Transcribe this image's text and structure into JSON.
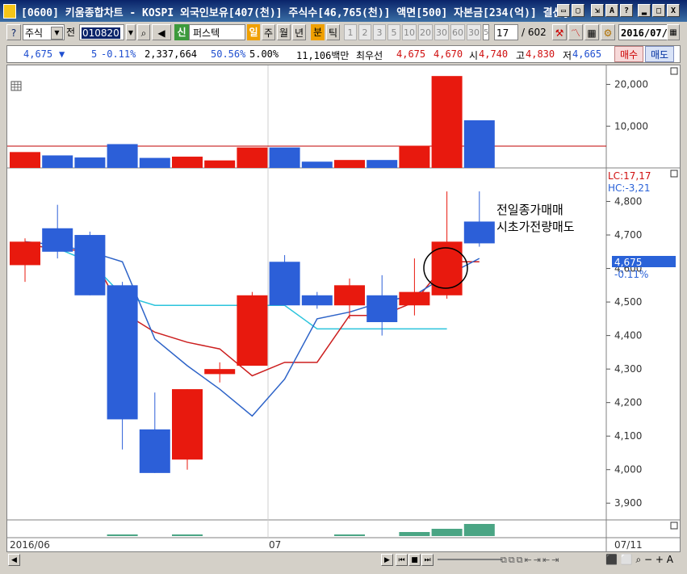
{
  "window": {
    "title": "[0600] 키움종합차트 - KOSPI 외국인보유[407(천)] 주식수[46,765(천)] 액면[500] 자본금[234(억)] 결산[",
    "controls": [
      "▭",
      "▢",
      "⇲",
      "A",
      "?",
      "▂",
      "□",
      "X"
    ]
  },
  "toolbar": {
    "market_label": "주식",
    "prev_label": "전",
    "code_value": "010820",
    "stock_name": "퍼스텍",
    "credit_label": "신",
    "period_tabs": [
      "일",
      "주",
      "월",
      "년",
      "분",
      "틱"
    ],
    "active_period": "일",
    "intervals": [
      "1",
      "2",
      "3",
      "5",
      "10",
      "20",
      "30",
      "60",
      "30",
      "5"
    ],
    "count_value": "17",
    "total_count": "/ 602",
    "date_value": "2016/07/1"
  },
  "quote": {
    "price": "4,675",
    "direction": "▼",
    "change": "5",
    "change_pct": "-0.11%",
    "volume": "2,337,664",
    "volume_ratio": "50.56%",
    "rate": "5.00%",
    "amount": "11,106백만",
    "best_label": "최우선",
    "ask": "4,675",
    "bid": "4,670",
    "open_label": "시",
    "open": "4,740",
    "high_label": "고",
    "high": "4,830",
    "low_label": "저",
    "low": "4,665",
    "buy_label": "매수",
    "sell_label": "매도"
  },
  "chart": {
    "lc_label": "LC:17,17",
    "hc_label": "HC:-3,21",
    "current_price_tag": "4,675",
    "current_change_tag": "-0.11%",
    "annotation_line1": "전일종가매매",
    "annotation_line2": "시초가전량매도",
    "date_labels": [
      "2016/06",
      "07",
      "07/11"
    ],
    "price_ticks": [
      "4,800",
      "4,700",
      "4,600",
      "4,500",
      "4,400",
      "4,300",
      "4,200",
      "4,100",
      "4,000",
      "3,900"
    ],
    "volume_ticks": [
      "20,000",
      "10,000"
    ],
    "colors": {
      "up": "#e8190e",
      "down": "#2c5fd8",
      "ma_short": "#2d63c8",
      "ma_mid": "#cc1f1f",
      "ma_long": "#2bc4dc",
      "vol_up": "#4aa584"
    }
  },
  "chart_data": {
    "type": "candlestick",
    "series": [
      {
        "name": "candles",
        "ohlc": [
          [
            4610,
            4690,
            4560,
            4680
          ],
          [
            4720,
            4790,
            4630,
            4650
          ],
          [
            4700,
            4710,
            4520,
            4520
          ],
          [
            4550,
            4560,
            4060,
            4150
          ],
          [
            4120,
            4230,
            3990,
            3990
          ],
          [
            4030,
            4240,
            4000,
            4240
          ],
          [
            4285,
            4320,
            4260,
            4300
          ],
          [
            4310,
            4530,
            4310,
            4520
          ],
          [
            4620,
            4640,
            4490,
            4490
          ],
          [
            4520,
            4530,
            4480,
            4490
          ],
          [
            4490,
            4570,
            4450,
            4550
          ],
          [
            4520,
            4580,
            4400,
            4440
          ],
          [
            4490,
            4630,
            4460,
            4530
          ],
          [
            4520,
            4830,
            4510,
            4680
          ],
          [
            4740,
            4830,
            4665,
            4675
          ]
        ]
      },
      {
        "name": "volume",
        "values": [
          3800,
          3000,
          2500,
          5700,
          2400,
          2700,
          1800,
          4900,
          4900,
          1500,
          1900,
          1900,
          5300,
          22000,
          11400
        ]
      },
      {
        "name": "ma_short",
        "values": [
          4680,
          4670,
          4650,
          4620,
          4390,
          4310,
          4240,
          4160,
          4270,
          4450,
          4470,
          4500,
          4520,
          4580,
          4630
        ]
      },
      {
        "name": "ma_mid",
        "values": [
          4670,
          4660,
          4650,
          4470,
          4410,
          4380,
          4360,
          4280,
          4320,
          4320,
          4460,
          4460,
          4500,
          4620,
          4620
        ]
      },
      {
        "name": "ma_long",
        "values": [
          4670,
          4660,
          4620,
          4520,
          4490,
          4490,
          4490,
          4490,
          4490,
          4420,
          4420,
          4420,
          4420,
          4420
        ]
      }
    ],
    "ylim": [
      3850,
      4900
    ],
    "volume_ylim": [
      0,
      23000
    ]
  }
}
